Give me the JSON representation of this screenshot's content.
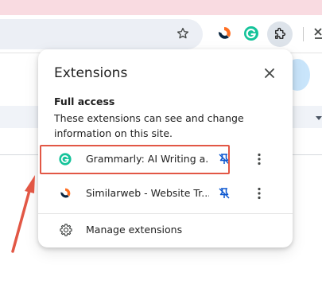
{
  "toolbar": {
    "star_icon": "star-outline-icon",
    "extensions": [
      {
        "name": "Similarweb",
        "icon": "similarweb-icon"
      },
      {
        "name": "Grammarly",
        "icon": "grammarly-icon"
      }
    ],
    "extensions_menu_icon": "puzzle-icon"
  },
  "popup": {
    "title": "Extensions",
    "close_icon": "close-icon",
    "section_title": "Full access",
    "section_desc": "These extensions can see and change information on this site.",
    "items": [
      {
        "label": "Grammarly: AI Writing a...",
        "icon": "grammarly-icon",
        "pinned": true,
        "color": "#15c39a"
      },
      {
        "label": "Similarweb - Website Tr...",
        "icon": "similarweb-icon",
        "pinned": true,
        "color": "#092540"
      }
    ],
    "manage_label": "Manage extensions"
  },
  "colors": {
    "highlight": "#e25745",
    "pin": "#0b57d0",
    "grammarly": "#15c39a",
    "similarweb_dark": "#092540",
    "similarweb_orange": "#ff6e21"
  }
}
